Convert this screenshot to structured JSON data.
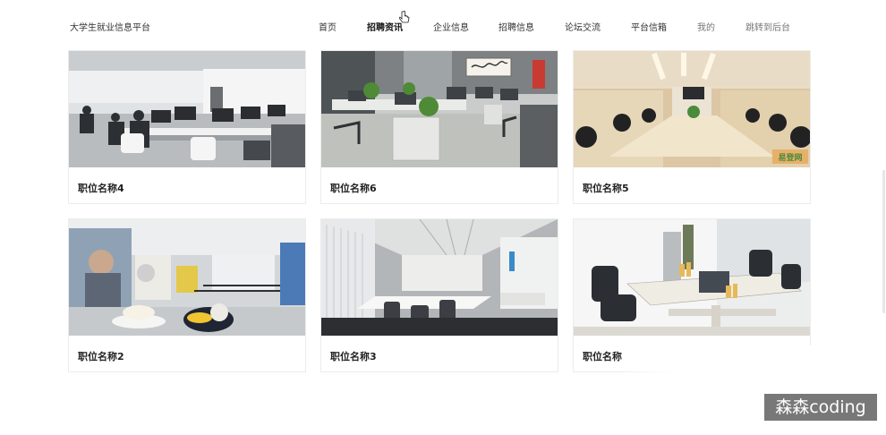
{
  "header": {
    "site_title": "大学生就业信息平台",
    "nav": [
      {
        "label": "首页"
      },
      {
        "label": "招聘资讯"
      },
      {
        "label": "企业信息"
      },
      {
        "label": "招聘信息"
      },
      {
        "label": "论坛交流"
      },
      {
        "label": "平台信箱"
      },
      {
        "label": "我的"
      },
      {
        "label": "跳转到后台"
      }
    ]
  },
  "jobs": [
    {
      "title": "职位名称4",
      "image": "office-workstations-photo"
    },
    {
      "title": "职位名称6",
      "image": "office-desks-calligraphy-photo"
    },
    {
      "title": "职位名称5",
      "image": "conference-room-photo"
    },
    {
      "title": "职位名称2",
      "image": "lounge-office-photo"
    },
    {
      "title": "职位名称3",
      "image": "open-office-photo"
    },
    {
      "title": "职位名称",
      "image": "desk-cluster-photo"
    }
  ],
  "watermark": {
    "text": "森森coding",
    "logo_text": "易登网"
  }
}
